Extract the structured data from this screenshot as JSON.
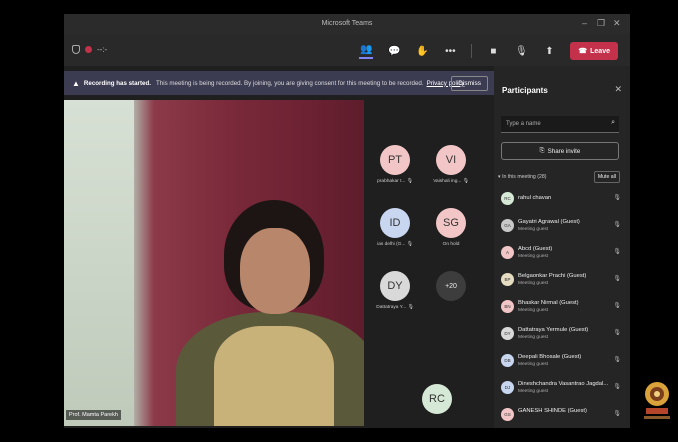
{
  "window": {
    "title": "Microsoft Teams",
    "controls": [
      "–",
      "❐",
      "✕"
    ]
  },
  "toolbar": {
    "timer": "--:-",
    "icons": [
      {
        "name": "participants-icon",
        "glyph": "👥",
        "active": true
      },
      {
        "name": "chat-icon",
        "glyph": "💬",
        "active": false
      },
      {
        "name": "react-icon",
        "glyph": "✋",
        "active": false
      },
      {
        "name": "more-icon",
        "glyph": "•••",
        "active": false
      }
    ],
    "camera_glyph": "■",
    "mic_glyph": "🎙",
    "share_glyph": "⬆",
    "leave_label": "Leave"
  },
  "banner": {
    "bold": "Recording has started.",
    "message": "This meeting is being recorded. By joining, you are giving consent for this meeting to be recorded.",
    "link": "Privacy policy",
    "dismiss": "Dismiss"
  },
  "video": {
    "name_tag": "Prof. Mamta Parekh"
  },
  "tiles": [
    {
      "initials": "PT",
      "label": "prabhakar t...",
      "color": "#f2c6c6"
    },
    {
      "initials": "VI",
      "label": "Vaishali ing...",
      "color": "#f2c6c6"
    },
    {
      "initials": "ID",
      "label": "ias delhi (G...",
      "color": "#c9d6f0"
    },
    {
      "initials": "SG",
      "label": "On hold",
      "color": "#f2c6c6"
    },
    {
      "initials": "DY",
      "label": "Dattatraya Y...",
      "color": "#d9d9d9"
    },
    {
      "initials": "+20",
      "label": "",
      "color": "#3d3d3d"
    },
    {
      "initials": "RC",
      "label": "",
      "color": "#d6e8d6"
    }
  ],
  "sidebar": {
    "title": "Participants",
    "search_placeholder": "Type a name",
    "share_invite": "Share invite",
    "in_meeting": "In this meeting (28)",
    "mute_all": "Mute all",
    "participants": [
      {
        "initials": "RC",
        "name": "rahul chavan",
        "sub": "",
        "color": "#d6e8d6"
      },
      {
        "initials": "GA",
        "name": "Gayatri Agrawal (Guest)",
        "sub": "Meeting guest",
        "color": "#c8c8c8"
      },
      {
        "initials": "A",
        "name": "Abcd (Guest)",
        "sub": "Meeting guest",
        "color": "#f2c6c6"
      },
      {
        "initials": "BP",
        "name": "Belgaonkar Prachi (Guest)",
        "sub": "Meeting guest",
        "color": "#e6dcc2"
      },
      {
        "initials": "BN",
        "name": "Bhaskar Nirmal (Guest)",
        "sub": "Meeting guest",
        "color": "#f2c6c6"
      },
      {
        "initials": "DY",
        "name": "Dattatraya Yermule (Guest)",
        "sub": "Meeting guest",
        "color": "#d9d9d9"
      },
      {
        "initials": "DB",
        "name": "Deepali Bhosale (Guest)",
        "sub": "Meeting guest",
        "color": "#c9d6f0"
      },
      {
        "initials": "DJ",
        "name": "Dineshchandra Vasantrao Jagdal...",
        "sub": "Meeting guest",
        "color": "#c9d6f0"
      },
      {
        "initials": "GS",
        "name": "GANESH SHINDE (Guest)",
        "sub": "",
        "color": "#f2c6c6"
      }
    ]
  }
}
